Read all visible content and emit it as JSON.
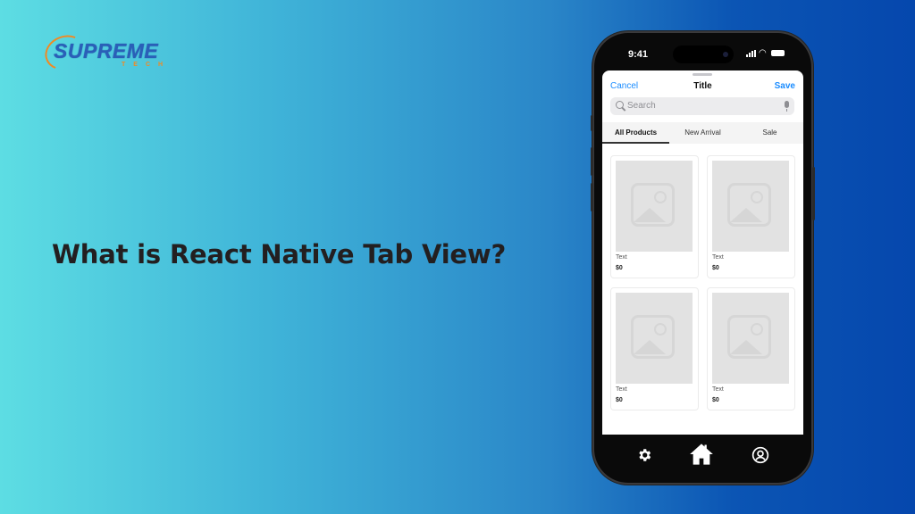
{
  "brand": {
    "name": "SUPREME",
    "sub": "TECH",
    "accent": "#f08a24",
    "primary": "#2a5fb8"
  },
  "headline": "What is React Native Tab View?",
  "phone": {
    "status": {
      "time": "9:41"
    },
    "nav": {
      "cancel": "Cancel",
      "title": "Title",
      "save": "Save"
    },
    "search": {
      "placeholder": "Search"
    },
    "tabs": [
      {
        "label": "All Products",
        "active": true
      },
      {
        "label": "New Arrival",
        "active": false
      },
      {
        "label": "Sale",
        "active": false
      }
    ],
    "products": [
      {
        "text": "Text",
        "price": "$0"
      },
      {
        "text": "Text",
        "price": "$0"
      },
      {
        "text": "Text",
        "price": "$0"
      },
      {
        "text": "Text",
        "price": "$0"
      }
    ],
    "tabbar": [
      {
        "icon": "gear-icon"
      },
      {
        "icon": "home-icon"
      },
      {
        "icon": "profile-icon"
      }
    ]
  }
}
